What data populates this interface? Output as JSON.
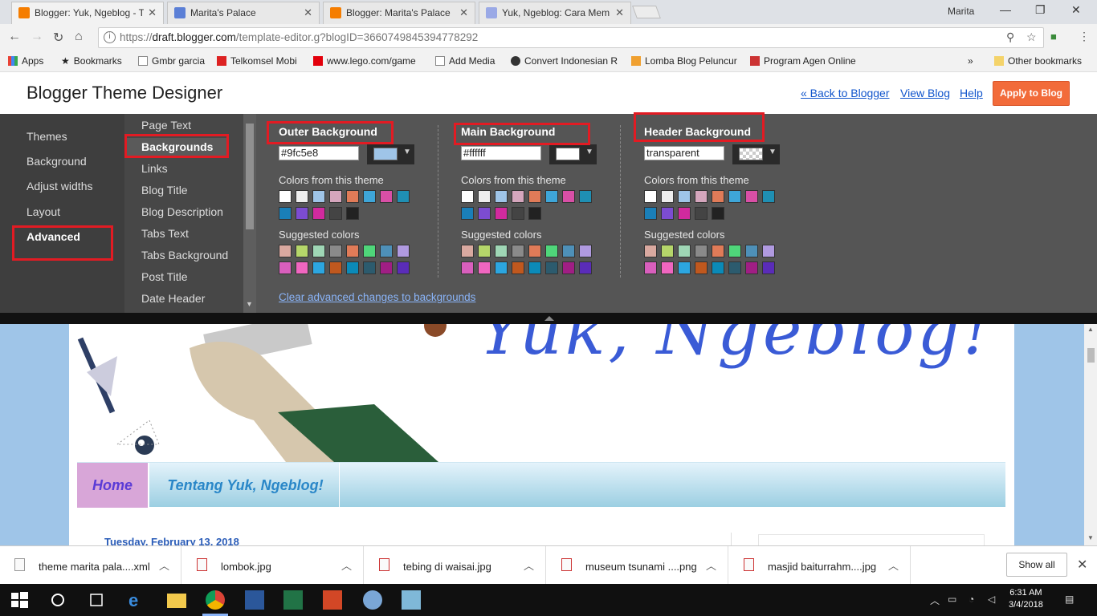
{
  "browser": {
    "tabs": [
      {
        "title": "Blogger: Yuk, Ngeblog - T",
        "icon": "blogger-icon",
        "color": "#f57d00"
      },
      {
        "title": "Marita's Palace",
        "icon": "blog-icon",
        "color": "#5b7fd6"
      },
      {
        "title": "Blogger: Marita's Palace",
        "icon": "blogger-icon",
        "color": "#f57d00"
      },
      {
        "title": "Yuk, Ngeblog: Cara Mem",
        "icon": "blog-icon",
        "color": "#9aa9e6"
      }
    ],
    "profile_name": "Marita",
    "url_prefix": "https://",
    "url_domain": "draft.blogger.com",
    "url_path": "/template-editor.g?blogID=3660749845394778292",
    "bookmarks": [
      {
        "label": "Apps"
      },
      {
        "label": "Bookmarks"
      },
      {
        "label": "Gmbr garcia"
      },
      {
        "label": "Telkomsel Mobi"
      },
      {
        "label": "www.lego.com/game"
      },
      {
        "label": "Add Media"
      },
      {
        "label": "Convert Indonesian R"
      },
      {
        "label": "Lomba Blog Peluncur"
      },
      {
        "label": "Program Agen Online"
      }
    ],
    "other_bookmarks": "Other bookmarks"
  },
  "designer": {
    "title": "Blogger Theme Designer",
    "back_link": "« Back to Blogger",
    "view_blog": "View Blog",
    "help": "Help",
    "apply": "Apply to Blog",
    "nav": [
      "Themes",
      "Background",
      "Adjust widths",
      "Layout",
      "Advanced"
    ],
    "subnav": [
      "Page Text",
      "Backgrounds",
      "Links",
      "Blog Title",
      "Blog Description",
      "Tabs Text",
      "Tabs Background",
      "Post Title",
      "Date Header"
    ],
    "theme_colors_label": "Colors from this theme",
    "suggested_label": "Suggested colors",
    "theme_colors": [
      "#ffffff",
      "#eeeeee",
      "#9fc5e8",
      "#d5a6bd",
      "#e07b58",
      "#3ea6d9",
      "#d94fa6",
      "#1f8fb3",
      "#1a7fb8",
      "#7c4cd1",
      "#d12a9e",
      "#444444",
      "#222222"
    ],
    "suggested_colors": [
      "#d9a9a0",
      "#b5d66a",
      "#9fd6b5",
      "#8a8a8a",
      "#e07b58",
      "#4fd67a",
      "#4e90b8",
      "#b09ae0",
      "#d95fbd",
      "#f066c0",
      "#2ca6e0",
      "#c0581e",
      "#0b8ab8",
      "#2c5b6e",
      "#a01e84",
      "#5a2cb8"
    ],
    "columns": [
      {
        "header": "Outer Background",
        "value": "#9fc5e8",
        "swatch": "#9fc5e8"
      },
      {
        "header": "Main Background",
        "value": "#ffffff",
        "swatch": "#ffffff"
      },
      {
        "header": "Header Background",
        "value": "transparent",
        "swatch": "transparent"
      }
    ],
    "clear_link": "Clear advanced changes to backgrounds"
  },
  "preview": {
    "blog_title": "Yuk, Ngeblog!",
    "tabs": [
      "Home",
      "Tentang Yuk, Ngeblog!"
    ],
    "date_header": "Tuesday, February 13, 2018",
    "outer_bg": "#9fc5e8"
  },
  "downloads": {
    "items": [
      {
        "name": "theme marita pala....xml",
        "type": "file"
      },
      {
        "name": "lombok.jpg",
        "type": "image"
      },
      {
        "name": "tebing di waisai.jpg",
        "type": "image"
      },
      {
        "name": "museum tsunami ....png",
        "type": "image"
      },
      {
        "name": "masjid baiturrahm....jpg",
        "type": "image"
      }
    ],
    "show_all": "Show all"
  },
  "taskbar": {
    "time": "6:31 AM",
    "date": "3/4/2018"
  }
}
